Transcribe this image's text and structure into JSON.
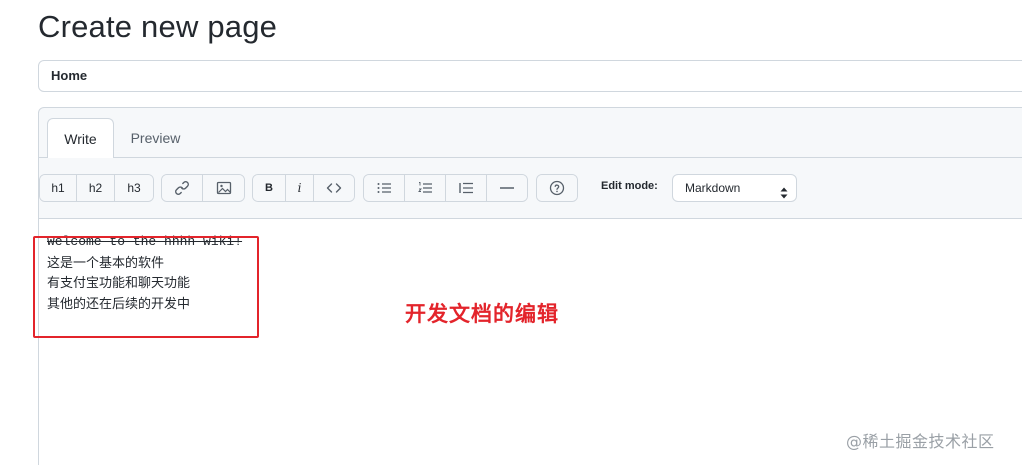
{
  "page": {
    "title": "Create new page"
  },
  "title_field": {
    "value": "Home"
  },
  "tabs": [
    {
      "label": "Write",
      "active": true
    },
    {
      "label": "Preview",
      "active": false
    }
  ],
  "toolbar": {
    "headings": [
      "h1",
      "h2",
      "h3"
    ],
    "link_icon": "link-icon",
    "image_icon": "image-icon",
    "bold": "B",
    "italic": "i",
    "code_icon": "code-icon",
    "unordered_list_icon": "unordered-list-icon",
    "ordered_list_icon": "ordered-list-icon",
    "quote_icon": "quote-icon",
    "hr_icon": "horizontal-rule-icon",
    "help_icon": "help-icon",
    "edit_mode_label": "Edit mode:",
    "edit_mode_value": "Markdown"
  },
  "editor_content": {
    "lines": [
      "Welcome to the hhhh wiki!",
      "这是一个基本的软件",
      "有支付宝功能和聊天功能",
      "其他的还在后续的开发中"
    ]
  },
  "annotation": {
    "text": "开发文档的编辑",
    "color": "#e3242b"
  },
  "watermark": {
    "text": "@稀土掘金技术社区"
  }
}
